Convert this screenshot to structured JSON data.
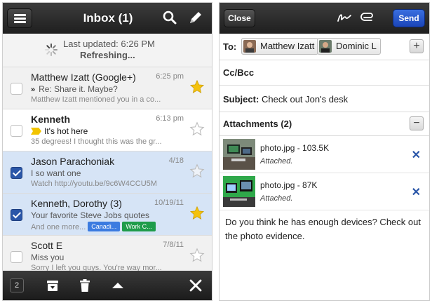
{
  "inbox": {
    "title": "Inbox (1)",
    "refresh": {
      "last_updated": "Last updated: 6:26 PM",
      "status": "Refreshing..."
    },
    "messages": [
      {
        "sender": "Matthew Izatt (Google+)",
        "date": "6:25 pm",
        "subject_prefix": "»",
        "subject": "Re: Share it. Maybe?",
        "snippet": "Matthew Izatt mentioned you in a co...",
        "checked": false,
        "starred": true,
        "unread": false,
        "selected": false
      },
      {
        "sender": "Kenneth",
        "date": "6:13 pm",
        "subject_prefix": "",
        "subject": "It's hot here",
        "snippet": "35 degrees! I thought this was the gr...",
        "checked": false,
        "starred": false,
        "unread": true,
        "selected": false,
        "important": true
      },
      {
        "sender": "Jason Parachoniak",
        "date": "4/18",
        "subject_prefix": "",
        "subject": "I so want one",
        "snippet": "Watch http://youtu.be/9c6W4CCU5M",
        "checked": true,
        "starred": false,
        "unread": false,
        "selected": true
      },
      {
        "sender": "Kenneth, Dorothy (3)",
        "date": "10/19/11",
        "subject_prefix": "",
        "subject": "Your favorite Steve Jobs quotes",
        "snippet": "And one more...",
        "checked": true,
        "starred": true,
        "unread": false,
        "selected": true,
        "labels": [
          "Canadi...",
          "Work C..."
        ]
      },
      {
        "sender": "Scott E",
        "date": "7/8/11",
        "subject_prefix": "",
        "subject": "Miss you",
        "snippet": "Sorry I left you guys. You're way mor...",
        "checked": false,
        "starred": false,
        "unread": false,
        "selected": false
      }
    ],
    "toolbar": {
      "selected_count": "2"
    },
    "colors": {
      "star": "#f4c20d",
      "label_blue": "#3b7be0",
      "label_green": "#1e9c4a",
      "checkbox": "#2a56a8",
      "selected_row": "#d6e4f6"
    }
  },
  "compose": {
    "close_label": "Close",
    "send_label": "Send",
    "to_label": "To:",
    "recipients": [
      "Matthew Izatt",
      "Dominic L"
    ],
    "cc_label": "Cc/Bcc",
    "subject_label": "Subject:",
    "subject_value": "Check out Jon's desk",
    "attachments_label": "Attachments (2)",
    "attachments": [
      {
        "name": "photo.jpg - 103.5K",
        "status": "Attached."
      },
      {
        "name": "photo.jpg - 87K",
        "status": "Attached."
      }
    ],
    "body": "Do you think he has enough devices? Check out the photo evidence.",
    "colors": {
      "send": "#1b45b8",
      "remove": "#2a56a8"
    }
  }
}
